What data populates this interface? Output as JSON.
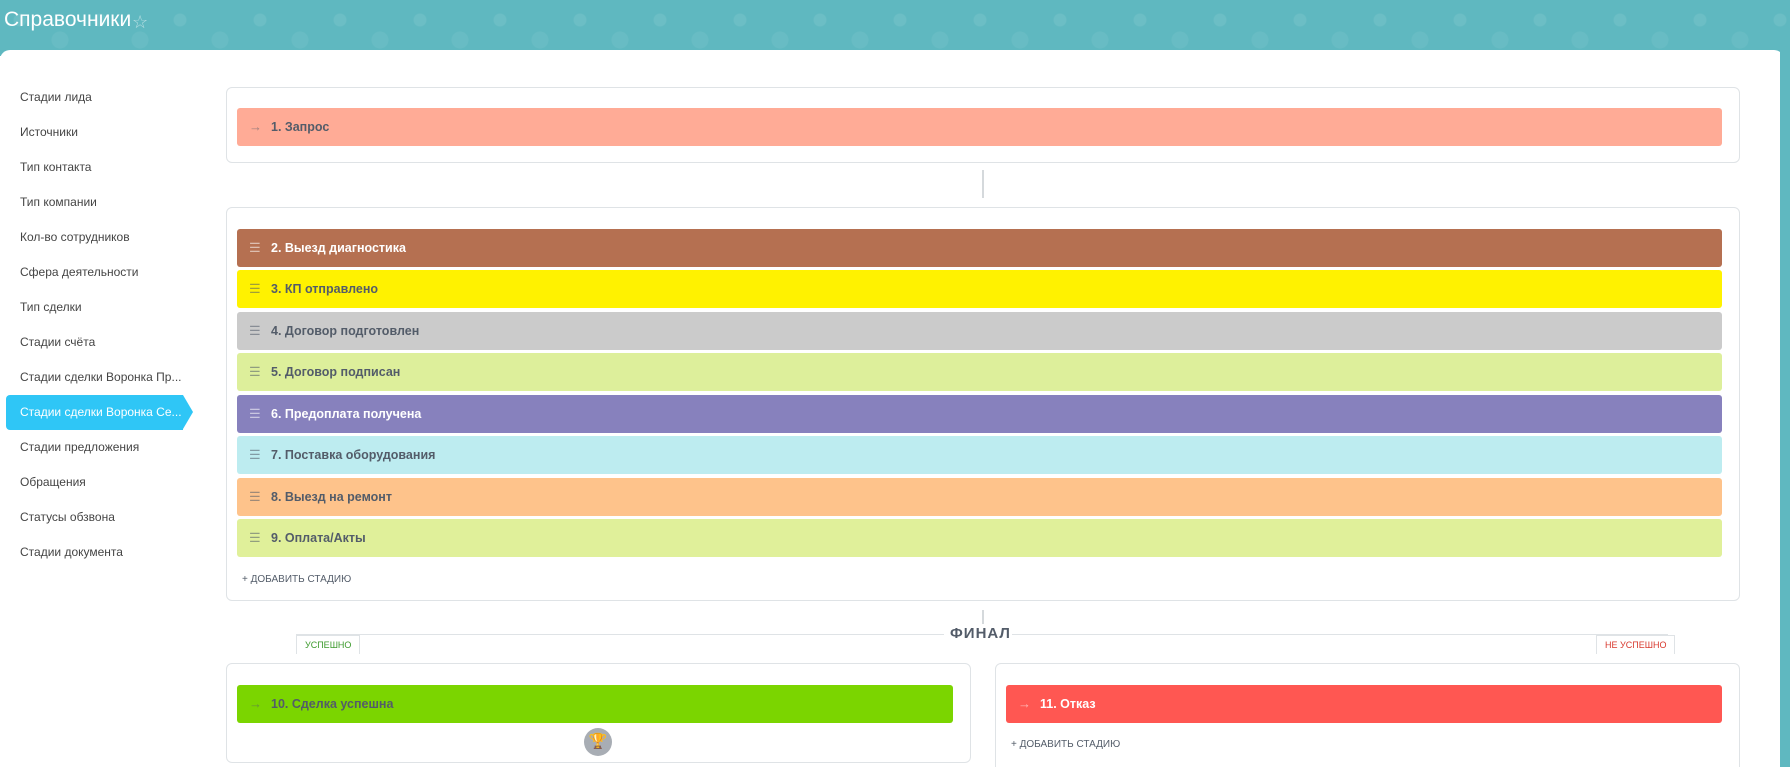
{
  "header": {
    "title": "Справочники",
    "star_icon": "star-icon"
  },
  "sidebar": {
    "items": [
      {
        "label": "Стадии лида"
      },
      {
        "label": "Источники"
      },
      {
        "label": "Тип контакта"
      },
      {
        "label": "Тип компании"
      },
      {
        "label": "Кол-во сотрудников"
      },
      {
        "label": "Сфера деятельности"
      },
      {
        "label": "Тип сделки"
      },
      {
        "label": "Стадии счёта"
      },
      {
        "label": "Стадии сделки Воронка Пр..."
      },
      {
        "label": "Стадии сделки Воронка Се...",
        "active": true
      },
      {
        "label": "Стадии предложения"
      },
      {
        "label": "Обращения"
      },
      {
        "label": "Статусы обзвона"
      },
      {
        "label": "Стадии документа"
      }
    ],
    "active_color": "#2fc6f6"
  },
  "initial_stage": {
    "label": "1. Запрос",
    "color": "#ffab96",
    "icon": "arrow-right-icon"
  },
  "stages": [
    {
      "label": "2. Выезд диагностика",
      "color": "#b57051",
      "text_color": "#ffffff"
    },
    {
      "label": "3. КП отправлено",
      "color": "#fff200",
      "text_color": "#535c69"
    },
    {
      "label": "4. Договор подготовлен",
      "color": "#cbcbcb",
      "text_color": "#535c69"
    },
    {
      "label": "5. Договор подписан",
      "color": "#ddef9b",
      "text_color": "#535c69"
    },
    {
      "label": "6. Предоплата получена",
      "color": "#8781bd",
      "text_color": "#ffffff"
    },
    {
      "label": "7. Поставка оборудования",
      "color": "#bdecf0",
      "text_color": "#535c69"
    },
    {
      "label": "8. Выезд на ремонт",
      "color": "#fec38b",
      "text_color": "#535c69"
    },
    {
      "label": "9. Оплата/Акты",
      "color": "#e0f09a",
      "text_color": "#535c69"
    }
  ],
  "add_stage_label": "+ ДОБАВИТЬ СТАДИЮ",
  "final": {
    "title": "ФИНАЛ",
    "success_tag": "УСПЕШНО",
    "fail_tag": "НЕ УСПЕШНО",
    "success_stage": {
      "label": "10. Сделка успешна",
      "color": "#7bd500"
    },
    "fail_stage": {
      "label": "11. Отказ",
      "color": "#ff5752"
    },
    "trophy_icon": "trophy-icon"
  }
}
